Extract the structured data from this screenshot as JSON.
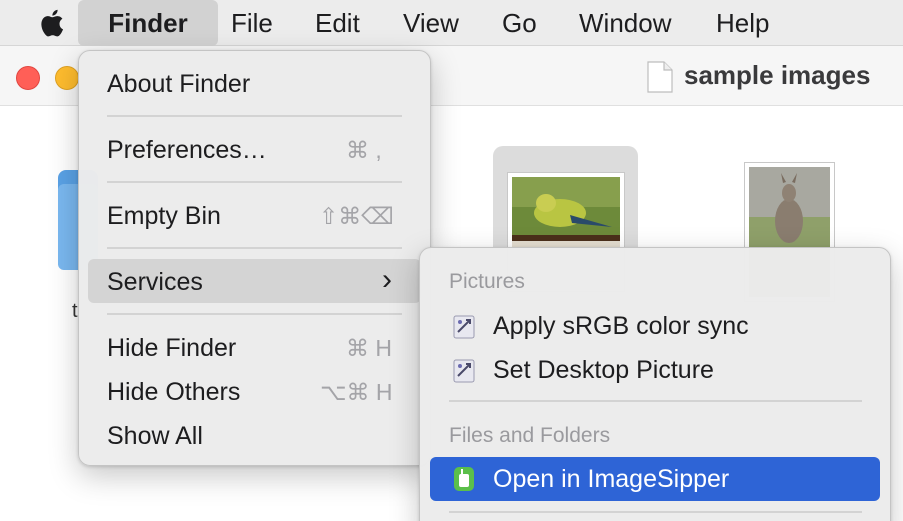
{
  "menubar": {
    "items": [
      {
        "label": "Finder"
      },
      {
        "label": "File"
      },
      {
        "label": "Edit"
      },
      {
        "label": "View"
      },
      {
        "label": "Go"
      },
      {
        "label": "Window"
      },
      {
        "label": "Help"
      }
    ]
  },
  "window": {
    "title": "sample images",
    "partial_label": "t"
  },
  "finder_menu": {
    "about": "About Finder",
    "preferences": {
      "label": "Preferences…",
      "shortcut": "⌘ ,"
    },
    "empty_bin": {
      "label": "Empty Bin",
      "shortcut": "⇧⌘⌫"
    },
    "services": {
      "label": "Services",
      "arrow": "›"
    },
    "hide_finder": {
      "label": "Hide Finder",
      "shortcut": "⌘ H"
    },
    "hide_others": {
      "label": "Hide Others",
      "shortcut": "⌥⌘ H"
    },
    "show_all": {
      "label": "Show All"
    }
  },
  "services_menu": {
    "pictures_header": "Pictures",
    "apply_srgb": "Apply sRGB color sync",
    "set_desktop": "Set Desktop Picture",
    "files_header": "Files and Folders",
    "open_imagesipper": "Open in ImageSipper"
  },
  "colors": {
    "highlight": "#2e64d6",
    "close": "#ff5f57",
    "minimize": "#febc2e"
  }
}
